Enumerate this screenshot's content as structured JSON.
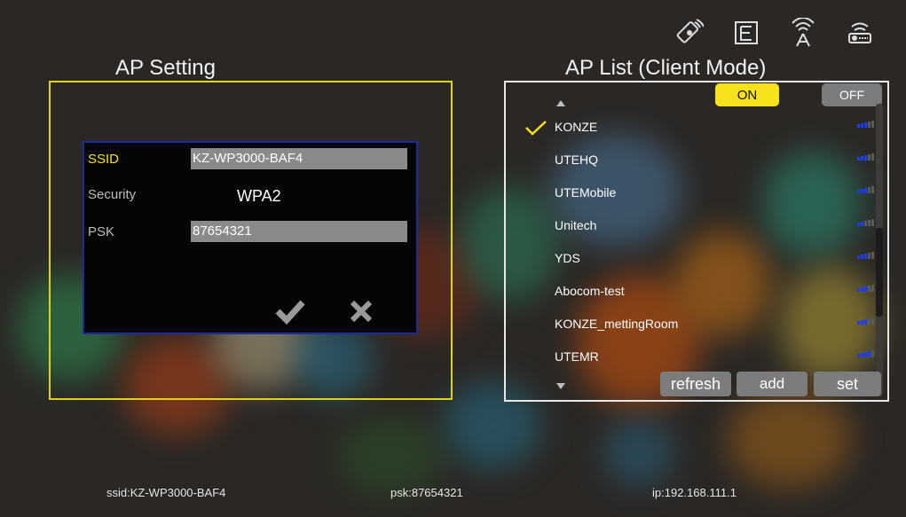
{
  "header": {
    "left_title": "AP Setting",
    "right_title": "AP List (Client Mode)",
    "icons": [
      "remote-control-icon",
      "network-tree-icon",
      "wifi-antenna-icon",
      "router-icon"
    ]
  },
  "ap_setting": {
    "ssid_label": "SSID",
    "ssid_value": "KZ-WP3000-BAF4",
    "security_label": "Security",
    "security_value": "WPA2",
    "psk_label": "PSK",
    "psk_value": "87654321"
  },
  "ap_list": {
    "on_label": "ON",
    "off_label": "OFF",
    "items": [
      {
        "name": "KONZE",
        "selected": true,
        "signal": 3
      },
      {
        "name": "UTEHQ",
        "selected": false,
        "signal": 3
      },
      {
        "name": "UTEMobile",
        "selected": false,
        "signal": 3
      },
      {
        "name": "Unitech",
        "selected": false,
        "signal": 2
      },
      {
        "name": "YDS",
        "selected": false,
        "signal": 3
      },
      {
        "name": "Abocom-test",
        "selected": false,
        "signal": 3
      },
      {
        "name": "KONZE_mettingRoom",
        "selected": false,
        "signal": 3
      },
      {
        "name": "UTEMR",
        "selected": false,
        "signal": 4
      }
    ],
    "refresh_label": "refresh",
    "add_label": "add",
    "set_label": "set"
  },
  "footer": {
    "ssid": "ssid:KZ-WP3000-BAF4",
    "psk": "psk:87654321",
    "ip": "ip:192.168.111.1"
  },
  "colors": {
    "accent_yellow": "#f5e21a",
    "dialog_border": "#1d2a9e",
    "signal_blue": "#1a3cff"
  }
}
